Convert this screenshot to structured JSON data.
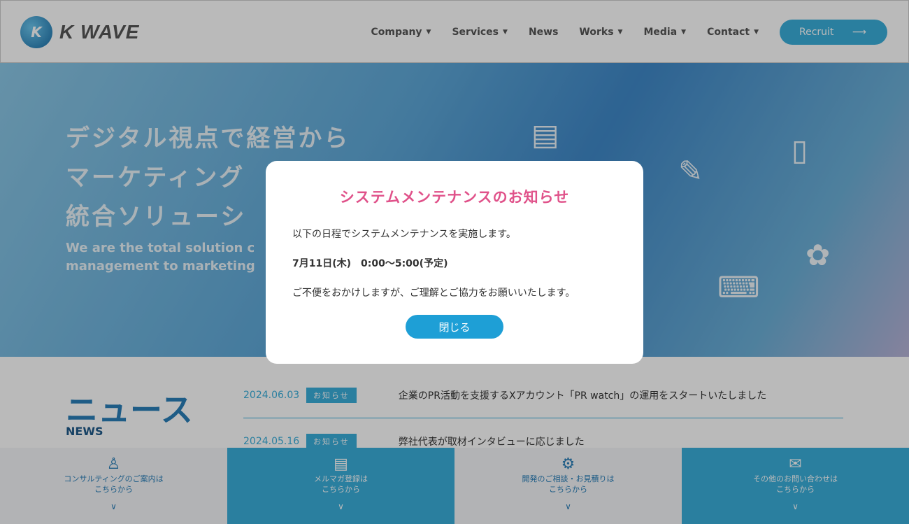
{
  "header": {
    "logo_text": "K WAVE",
    "nav": [
      {
        "label": "Company",
        "dropdown": true
      },
      {
        "label": "Services",
        "dropdown": true
      },
      {
        "label": "News",
        "dropdown": false
      },
      {
        "label": "Works",
        "dropdown": true
      },
      {
        "label": "Media",
        "dropdown": true
      },
      {
        "label": "Contact",
        "dropdown": true
      }
    ],
    "recruit_label": "Recruit",
    "recruit_arrow": "⟶"
  },
  "hero": {
    "jp_lines": [
      "デジタル視点で経営から",
      "マーケティング",
      "統合ソリューシ"
    ],
    "en_lines": [
      "We are the total solution c",
      "management to marketing"
    ]
  },
  "news": {
    "title": "ニュース",
    "subtitle": "NEWS",
    "items": [
      {
        "date": "2024.06.03",
        "badge": "お知らせ",
        "text": "企業のPR活動を支援するXアカウント「PR watch」の運用をスタートいたしました"
      },
      {
        "date": "2024.05.16",
        "badge": "お知らせ",
        "text": "弊社代表が取材インタビューに応じました"
      }
    ]
  },
  "footer": {
    "panels": [
      {
        "line1": "コンサルティングのご案内は",
        "line2": "こちらから",
        "icon": "person-icon"
      },
      {
        "line1": "メルマガ登録は",
        "line2": "こちらから",
        "icon": "document-icon"
      },
      {
        "line1": "開発のご相談・お見積りは",
        "line2": "こちらから",
        "icon": "gear-icon"
      },
      {
        "line1": "その他のお問い合わせは",
        "line2": "こちらから",
        "icon": "mail-icon"
      }
    ],
    "chevron": "∨"
  },
  "modal": {
    "title": "システムメンテナンスのお知らせ",
    "line1": "以下の日程でシステムメンテナンスを実施します。",
    "schedule": "7月11日(木)　0:00〜5:00(予定)",
    "line3": "ご不便をおかけしますが、ご理解とご協力をお願いいたします。",
    "close_label": "閉じる"
  },
  "colors": {
    "accent": "#3aaedb",
    "modal_title": "#e0528a",
    "button": "#1e9fd6"
  }
}
